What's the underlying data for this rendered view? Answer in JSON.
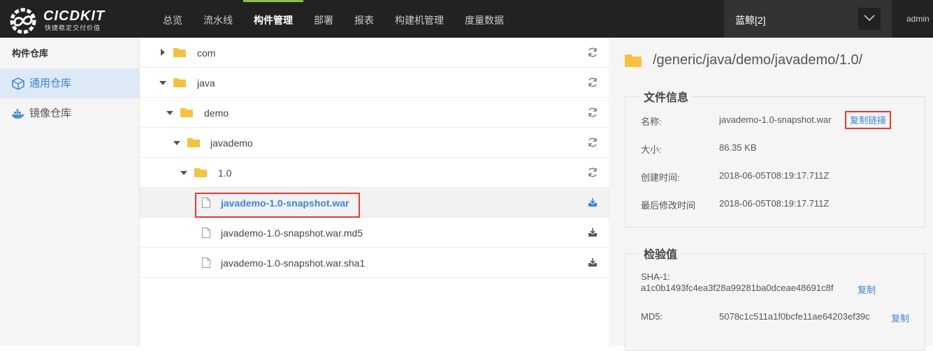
{
  "brand": {
    "title": "CICDKIT",
    "subtitle": "快捷稳定交付价值"
  },
  "nav": [
    "总览",
    "流水线",
    "构件管理",
    "部署",
    "报表",
    "构建机管理",
    "度量数据"
  ],
  "nav_active": "构件管理",
  "project": {
    "name": "蓝鲸[2]"
  },
  "user": "admin",
  "sidebar": {
    "title": "构件仓库",
    "items": [
      {
        "label": "通用仓库",
        "icon": "cube-icon",
        "active": true
      },
      {
        "label": "镜像仓库",
        "icon": "docker-whale-icon",
        "active": false
      }
    ]
  },
  "tree": {
    "rows": [
      {
        "label": "com",
        "type": "folder",
        "expanded": false,
        "action": "refresh-icon"
      },
      {
        "label": "java",
        "type": "folder",
        "expanded": true,
        "action": "refresh-icon"
      },
      {
        "label": "demo",
        "type": "folder",
        "expanded": true,
        "action": "refresh-icon"
      },
      {
        "label": "javademo",
        "type": "folder",
        "expanded": true,
        "action": "refresh-icon"
      },
      {
        "label": "1.0",
        "type": "folder",
        "expanded": true,
        "action": "refresh-icon"
      },
      {
        "label": "javademo-1.0-snapshot.war",
        "type": "file",
        "selected": true,
        "action": "download-icon"
      },
      {
        "label": "javademo-1.0-snapshot.war.md5",
        "type": "file",
        "action": "download-icon"
      },
      {
        "label": "javademo-1.0-snapshot.war.sha1",
        "type": "file",
        "action": "download-icon"
      }
    ]
  },
  "detail": {
    "path": "/generic/java/demo/javademo/1.0/",
    "file_info": {
      "title": "文件信息",
      "name_label": "名称:",
      "name_value": "javademo-1.0-snapshot.war",
      "copy_link": "复制链接",
      "size_label": "大小:",
      "size_value": "86.35 KB",
      "created_label": "创建时间:",
      "created_value": "2018-06-05T08:19:17.711Z",
      "modified_label": "最后修改时间",
      "modified_value": "2018-06-05T08:19:17.711Z"
    },
    "checksum": {
      "title": "检验值",
      "sha1_label": "SHA-1:",
      "sha1_value": "a1c0b1493fc4ea3f28a99281ba0dceae48691c8f",
      "sha1_copy": "复制",
      "md5_label": "MD5:",
      "md5_value": "5078c1c511a1f0bcfe11ae64203ef39c",
      "md5_copy": "复制"
    }
  },
  "colors": {
    "accent": "#3c86d4",
    "folder": "#f6c142",
    "nav_active_bar": "#8bc34a",
    "highlight": "#e53935"
  }
}
